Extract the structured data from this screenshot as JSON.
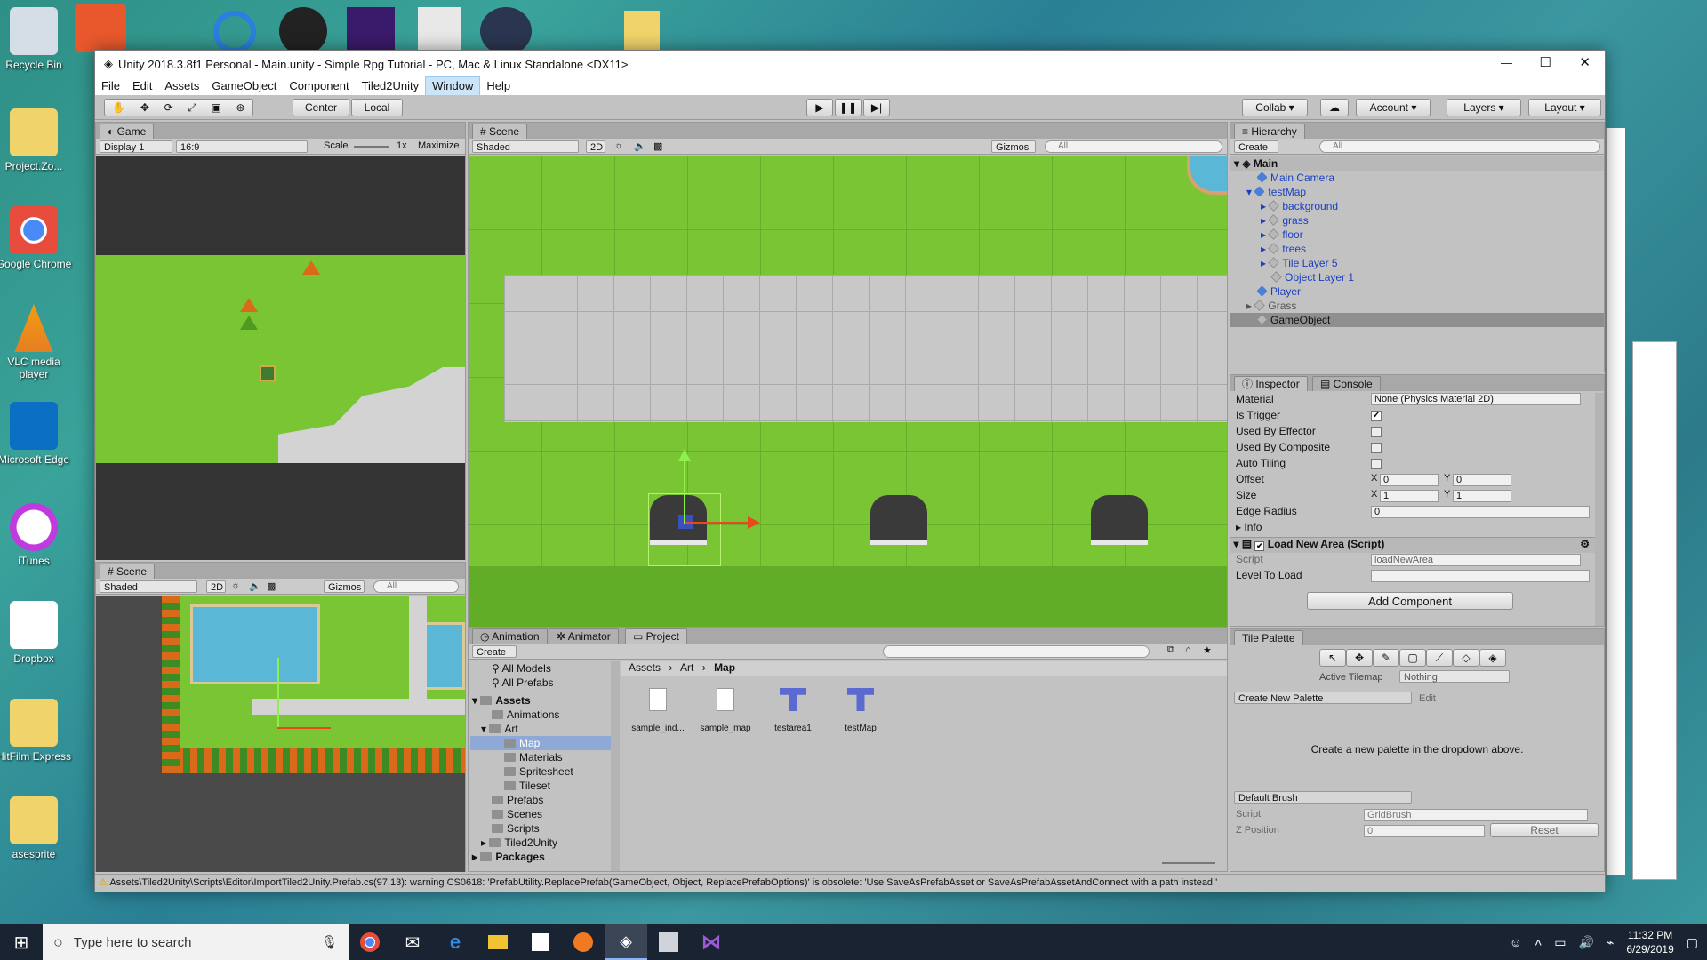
{
  "desktop": {
    "icons": [
      {
        "label": "Recycle Bin",
        "color": "#d5dde6"
      },
      {
        "label": "Project.Zo...",
        "color": "#f1d36b"
      },
      {
        "label": "Google Chrome",
        "color": "#e74c3c"
      },
      {
        "label": "VLC media player",
        "color": "#f39c12"
      },
      {
        "label": "Microsoft Edge",
        "color": "#0b6fc4"
      },
      {
        "label": "iTunes",
        "color": "#e8e8f0"
      },
      {
        "label": "Dropbox",
        "color": "#ffffff"
      },
      {
        "label": "HitFilm Express",
        "color": "#f1d36b"
      },
      {
        "label": "asesprite",
        "color": "#f1d36b"
      }
    ]
  },
  "window": {
    "title": "Unity 2018.3.8f1 Personal - Main.unity - Simple Rpg Tutorial - PC, Mac & Linux Standalone <DX11>"
  },
  "menu": [
    "File",
    "Edit",
    "Assets",
    "GameObject",
    "Component",
    "Tiled2Unity",
    "Window",
    "Help"
  ],
  "toolbar": {
    "center": "Center",
    "local": "Local",
    "collab": "Collab ▾",
    "account": "Account",
    "layers": "Layers",
    "layout": "Layout"
  },
  "game": {
    "tab": "Game",
    "display": "Display 1",
    "aspect": "16:9",
    "scale_label": "Scale",
    "scale_val": "1x",
    "maximize": "Maximize"
  },
  "scene": {
    "tab": "Scene",
    "shaded": "Shaded",
    "mode2d": "2D",
    "gizmos": "Gizmos",
    "search": "All"
  },
  "scene_small": {
    "tab": "Scene",
    "shaded": "Shaded",
    "mode2d": "2D",
    "gizmos": "Gizmos",
    "search": "All"
  },
  "hierarchy": {
    "tab": "Hierarchy",
    "create": "Create",
    "search": "All",
    "scene_name": "Main",
    "items": [
      "Main Camera",
      "testMap",
      "background",
      "grass",
      "floor",
      "trees",
      "Tile Layer 5",
      "Object Layer 1",
      "Player",
      "Grass",
      "GameObject"
    ]
  },
  "inspector": {
    "tab": "Inspector",
    "console": "Console",
    "rows": [
      {
        "label": "Material",
        "value": "None (Physics Material 2D)"
      },
      {
        "label": "Is Trigger",
        "checked": true
      },
      {
        "label": "Used By Effector",
        "checked": false
      },
      {
        "label": "Used By Composite",
        "checked": false
      },
      {
        "label": "Auto Tiling",
        "checked": false
      }
    ],
    "offset": {
      "label": "Offset",
      "x": "0",
      "y": "0"
    },
    "size": {
      "label": "Size",
      "x": "1",
      "y": "1"
    },
    "edge": {
      "label": "Edge Radius",
      "value": "0"
    },
    "info": "Info",
    "component": "Load New Area (Script)",
    "script_label": "Script",
    "script_value": "loadNewArea",
    "level_label": "Level To Load",
    "add_component": "Add Component"
  },
  "bottom_tabs": {
    "animation": "Animation",
    "animator": "Animator",
    "project": "Project"
  },
  "project": {
    "create": "Create",
    "breadcrumb": [
      "Assets",
      "Art",
      "Map"
    ],
    "favorites": [
      "All Models",
      "All Prefabs"
    ],
    "tree": [
      "Assets",
      "Animations",
      "Art",
      "Map",
      "Materials",
      "Spritesheet",
      "Tileset",
      "Prefabs",
      "Scenes",
      "Scripts",
      "Tiled2Unity",
      "Packages"
    ],
    "files": [
      "sample_ind...",
      "sample_map",
      "testarea1",
      "testMap"
    ]
  },
  "tile_palette": {
    "tab": "Tile Palette",
    "active_tilemap_label": "Active Tilemap",
    "active_tilemap": "Nothing",
    "create_palette": "Create New Palette",
    "edit": "Edit",
    "empty_msg": "Create a new palette in the dropdown above.",
    "brush": "Default Brush",
    "script_label": "Script",
    "script_value": "GridBrush",
    "zpos_label": "Z Position",
    "zpos_value": "0",
    "reset": "Reset"
  },
  "status": {
    "warning": "Assets\\Tiled2Unity\\Scripts\\Editor\\ImportTiled2Unity.Prefab.cs(97,13): warning CS0618: 'PrefabUtility.ReplacePrefab(GameObject, Object, ReplacePrefabOptions)' is obsolete: 'Use SaveAsPrefabAsset or SaveAsPrefabAssetAndConnect with a path instead.'"
  },
  "taskbar": {
    "search": "Type here to search",
    "time": "11:32 PM",
    "date": "6/29/2019"
  }
}
